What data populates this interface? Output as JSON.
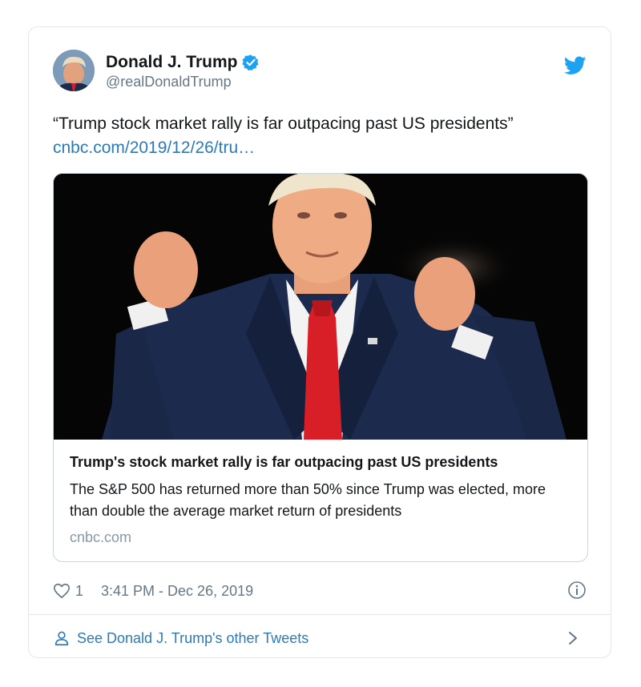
{
  "author": {
    "display_name": "Donald J. Trump",
    "handle": "@realDonaldTrump",
    "verified": true
  },
  "icons": {
    "avatar": "avatar-photo",
    "verified": "verified-badge-icon",
    "brand": "twitter-bird-icon",
    "like": "heart-icon",
    "info": "info-icon",
    "profile": "person-icon",
    "next": "chevron-right-icon"
  },
  "tweet": {
    "text": "“Trump stock market rally is far outpacing past US presidents”",
    "link_text": "cnbc.com/2019/12/26/tru…"
  },
  "link_card": {
    "title": "Trump's stock market rally is far outpacing past US presidents",
    "description": "The S&P 500 has returned more than 50% since Trump was elected, more than double the average market return of presidents",
    "domain": "cnbc.com"
  },
  "meta": {
    "like_count": "1",
    "timestamp": "3:41 PM - Dec 26, 2019"
  },
  "footer": {
    "cta": "See Donald J. Trump's other Tweets"
  },
  "colors": {
    "accent": "#1da1f2",
    "link": "#2b7bb9",
    "muted": "#657786",
    "border": "#e1e8ed"
  }
}
